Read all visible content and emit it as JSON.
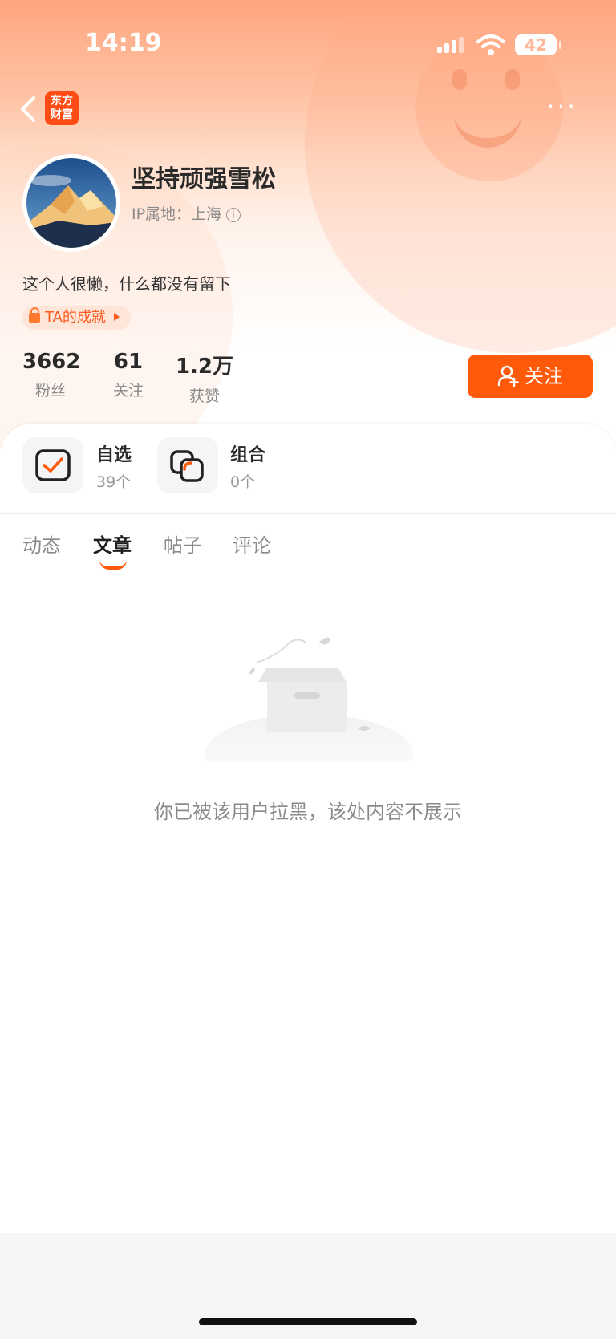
{
  "status_bar": {
    "time": "14:19",
    "battery": "42"
  },
  "nav": {
    "logo_line1": "东方",
    "logo_line2": "财富",
    "more": "···"
  },
  "profile": {
    "username": "坚持顽强雪松",
    "ip_location": "IP属地：上海",
    "bio": "这个人很懒，什么都没有留下",
    "achievement_label": "TA的成就"
  },
  "stats": [
    {
      "value": "3662",
      "label": "粉丝"
    },
    {
      "value": "61",
      "label": "关注"
    },
    {
      "value": "1.2万",
      "label": "获赞"
    }
  ],
  "follow_button": "关注",
  "tools": [
    {
      "title": "自选",
      "count": "39个"
    },
    {
      "title": "组合",
      "count": "0个"
    }
  ],
  "tabs": [
    {
      "label": "动态"
    },
    {
      "label": "文章"
    },
    {
      "label": "帖子"
    },
    {
      "label": "评论"
    }
  ],
  "active_tab": "文章",
  "empty_message": "你已被该用户拉黑，该处内容不展示",
  "colors": {
    "accent": "#ff5a0a",
    "header_gradient_top": "#ffa57f"
  }
}
